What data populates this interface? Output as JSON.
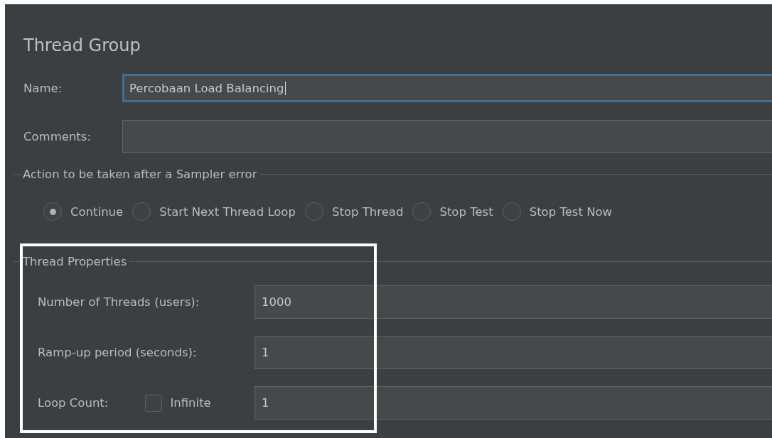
{
  "title": "Thread Group",
  "name": {
    "label": "Name:",
    "value": "Percobaan Load Balancing",
    "focused": true
  },
  "comments": {
    "label": "Comments:"
  },
  "sampler_error": {
    "legend": "Action to be taken after a Sampler error",
    "options": [
      {
        "label": "Continue",
        "selected": true
      },
      {
        "label": "Start Next Thread Loop",
        "selected": false
      },
      {
        "label": "Stop Thread",
        "selected": false
      },
      {
        "label": "Stop Test",
        "selected": false
      },
      {
        "label": "Stop Test Now",
        "selected": false
      }
    ]
  },
  "thread_properties": {
    "legend": "Thread Properties",
    "threads": {
      "label": "Number of Threads (users):",
      "value": "1000"
    },
    "ramp_up": {
      "label": "Ramp-up period (seconds):",
      "value": "1"
    },
    "loop_count": {
      "label": "Loop Count:",
      "infinite": {
        "label": "Infinite",
        "checked": false
      },
      "value": "1"
    }
  }
}
